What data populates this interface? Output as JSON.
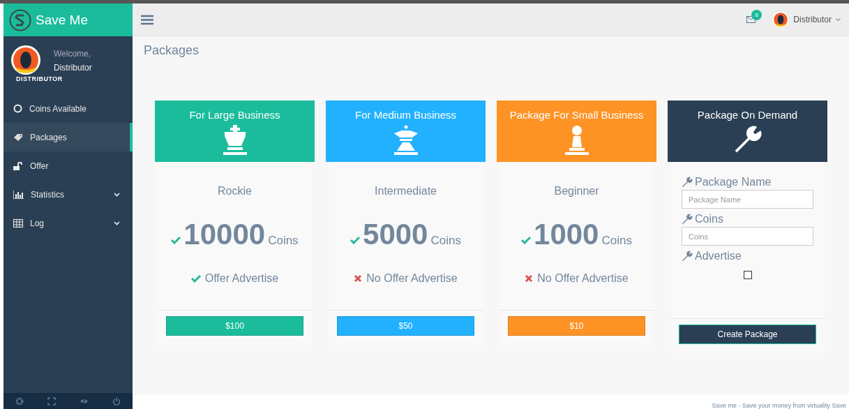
{
  "brand": {
    "name": "Save Me"
  },
  "profile": {
    "greeting": "Welcome,",
    "name": "Distributor",
    "role": "DISTRIBUTOR"
  },
  "sidebar": {
    "items": [
      {
        "label": "Coins Available",
        "selected": false,
        "expandable": false
      },
      {
        "label": "Packages",
        "selected": true,
        "expandable": false
      },
      {
        "label": "Offer",
        "selected": false,
        "expandable": false
      },
      {
        "label": "Statistics",
        "selected": false,
        "expandable": true
      },
      {
        "label": "Log",
        "selected": false,
        "expandable": true
      }
    ]
  },
  "topbar": {
    "mail_count": "6",
    "user": "Distributor"
  },
  "page_title": "Packages",
  "packages": [
    {
      "kind": "coins",
      "header": "For Large Business",
      "color": "#1abc9c",
      "name": "Rockie",
      "amount": "10000",
      "unit": "Coins",
      "offer": "Offer Advertise",
      "offer_included": true,
      "button": "$100"
    },
    {
      "kind": "coins",
      "header": "For Medium Business",
      "color": "#22b1fe",
      "name": "Intermediate",
      "amount": "5000",
      "unit": "Coins",
      "offer": "No Offer Advertise",
      "offer_included": false,
      "button": "$50"
    },
    {
      "kind": "coins",
      "header": "Package For Small Business",
      "color": "#fe9325",
      "name": "Beginner",
      "amount": "1000",
      "unit": "Coins",
      "offer": "No Offer Advertise",
      "offer_included": false,
      "button": "$10"
    },
    {
      "kind": "form",
      "header": "Package On Demand",
      "color": "#2a3f54",
      "fields": [
        {
          "kind": "text",
          "label": "Package Name",
          "placeholder": "Package Name"
        },
        {
          "kind": "number",
          "label": "Coins",
          "placeholder": "Coins"
        },
        {
          "kind": "checkbox",
          "label": "Advertise",
          "checked": false
        }
      ],
      "button": "Create Package"
    }
  ],
  "footer": "Save me - Save your money from virtuality Save"
}
